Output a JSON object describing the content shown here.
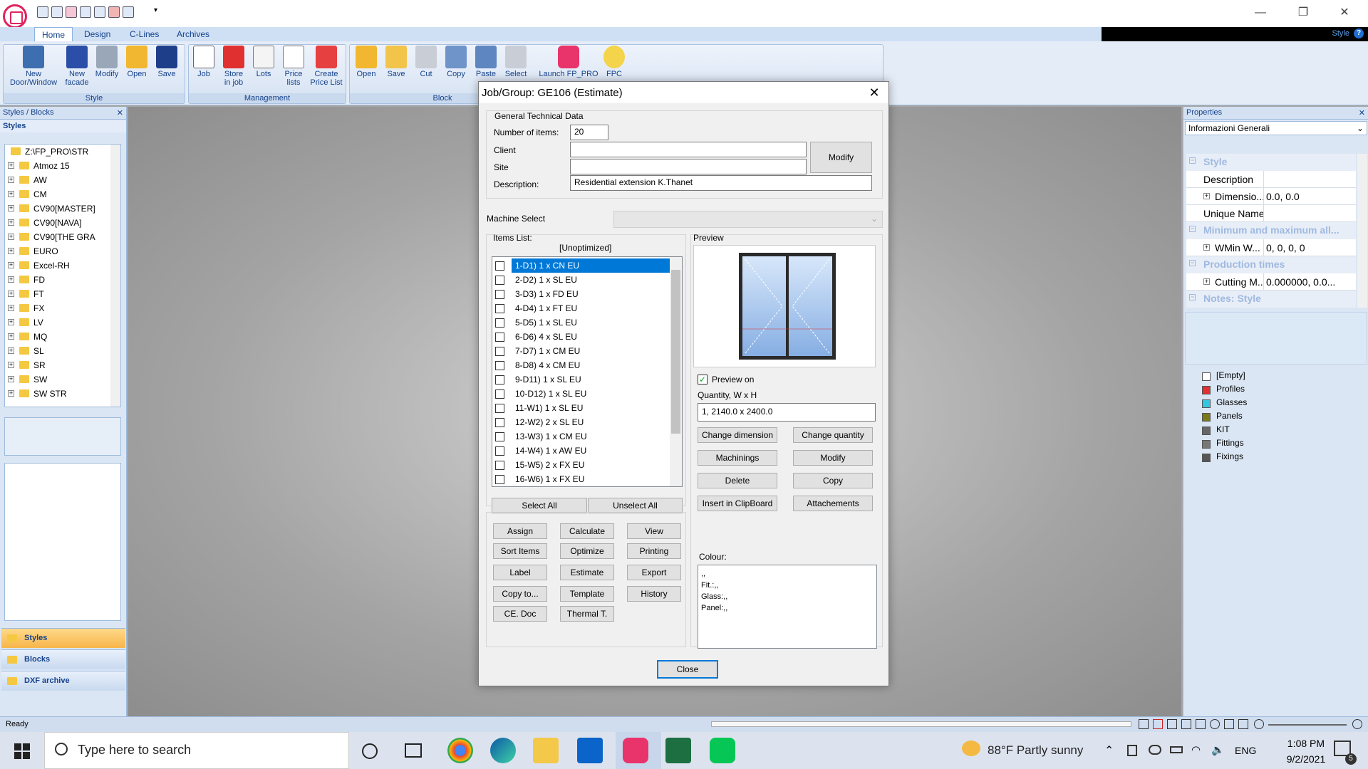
{
  "ribbon": {
    "tabs": [
      "Home",
      "Design",
      "C-Lines",
      "Archives"
    ],
    "style_dropdown": "Style",
    "groups": [
      {
        "label": "Style",
        "buttons": [
          "New\nDoor/Window",
          "New\nfacade",
          "Modify",
          "Open",
          "Save"
        ]
      },
      {
        "label": "Management",
        "buttons": [
          "Job",
          "Store\nin job",
          "Lots",
          "Price\nlists",
          "Create\nPrice List"
        ]
      },
      {
        "label": "Block",
        "buttons": [
          "Open",
          "Save",
          "Cut",
          "Copy",
          "Paste",
          "Select"
        ]
      },
      {
        "label": "",
        "buttons": [
          "Launch FP_PRO",
          "FPC"
        ]
      }
    ]
  },
  "left_panel": {
    "title": "Styles / Blocks",
    "subtitle": "Styles",
    "root": "Z:\\FP_PRO\\STR",
    "folders": [
      "Atmoz 15",
      "AW",
      "CM",
      "CV90[MASTER]",
      "CV90[NAVA]",
      "CV90[THE GRA",
      "EURO",
      "Excel-RH",
      "FD",
      "FT",
      "FX",
      "LV",
      "MQ",
      "SL",
      "SR",
      "SW",
      "SW STR"
    ],
    "nav_buttons": [
      "Styles",
      "Blocks",
      "DXF archive"
    ]
  },
  "dialog": {
    "title": "Job/Group: GE106 (Estimate)",
    "general_title": "General Technical Data",
    "number_label": "Number of items:",
    "number_value": "20",
    "client_label": "Client",
    "client_value": "",
    "site_label": "Site",
    "site_value": "",
    "modify_label": "Modify",
    "description_label": "Description:",
    "description_value": "Residential extension K.Thanet",
    "machine_label": "Machine Select",
    "items_label": "Items List:",
    "unoptimized": "[Unoptimized]",
    "items": [
      "1-D1) 1 x CN EU",
      "2-D2) 1 x SL EU",
      "3-D3) 1 x FD EU",
      "4-D4) 1 x FT EU",
      "5-D5) 1 x SL EU",
      "6-D6) 4 x SL EU",
      "7-D7) 1 x CM EU",
      "8-D8) 4 x CM EU",
      "9-D11) 1 x SL EU",
      "10-D12) 1 x SL EU",
      "11-W1) 1 x SL EU",
      "12-W2) 2 x SL EU",
      "13-W3) 1 x CM EU",
      "14-W4) 1 x AW EU",
      "15-W5) 2 x FX EU",
      "16-W6) 1 x FX EU"
    ],
    "select_all": "Select All",
    "unselect_all": "Unselect All",
    "actions_col1": [
      "Assign",
      "Sort Items",
      "Label",
      "Copy to...",
      "CE. Doc"
    ],
    "actions_col2": [
      "Calculate",
      "Optimize",
      "Estimate",
      "Template",
      "Thermal T."
    ],
    "actions_col3": [
      "View",
      "Printing",
      "Export",
      "History"
    ],
    "preview_label": "Preview",
    "preview_on": "Preview on",
    "qty_label": "Quantity, W x H",
    "qty_value": "1, 2140.0 x 2400.0",
    "preview_buttons": [
      "Change dimension",
      "Change quantity",
      "Machinings",
      "Modify",
      "Delete",
      "Copy",
      "Insert in ClipBoard",
      "Attachements"
    ],
    "colour_label": "Colour:",
    "colour_lines": [
      ",,",
      "Fit.:,,",
      "Glass:,,",
      "Panel:,,"
    ],
    "close_label": "Close"
  },
  "properties": {
    "title": "Properties",
    "dropdown": "Informazioni Generali",
    "rows": [
      {
        "type": "cat",
        "label": "Style"
      },
      {
        "type": "row",
        "label": "Description",
        "value": ""
      },
      {
        "type": "sub",
        "label": "Dimensio...",
        "value": "0.0, 0.0"
      },
      {
        "type": "row",
        "label": "Unique Name",
        "value": ""
      },
      {
        "type": "cat",
        "label": "Minimum and maximum all..."
      },
      {
        "type": "sub",
        "label": "WMin W...",
        "value": "0, 0, 0, 0"
      },
      {
        "type": "cat",
        "label": "Production times"
      },
      {
        "type": "sub",
        "label": "Cutting M...",
        "value": "0.000000, 0.0..."
      },
      {
        "type": "cat",
        "label": "Notes: Style"
      }
    ],
    "legend": [
      "[Empty]",
      "Profiles",
      "Glasses",
      "Panels",
      "KIT",
      "Fittings",
      "Fixings"
    ]
  },
  "status": {
    "text": "Ready"
  },
  "taskbar": {
    "search_placeholder": "Type here to search",
    "weather": "88°F  Partly sunny",
    "lang": "ENG",
    "time": "1:08 PM",
    "date": "9/2/2021",
    "notif_count": "5"
  }
}
